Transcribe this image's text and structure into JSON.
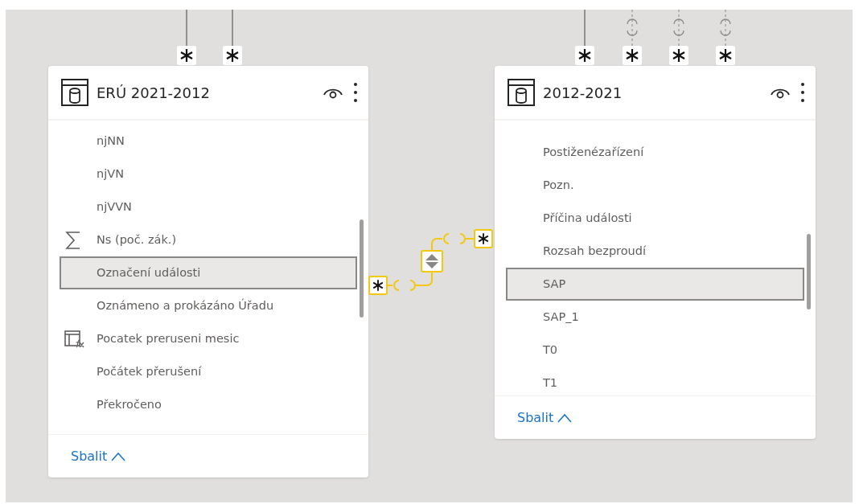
{
  "tables": [
    {
      "title": "ERÚ 2021-2012",
      "connectors": [
        {
          "active": true
        },
        {
          "active": true
        }
      ],
      "fields": [
        {
          "name": "njNN",
          "kind": "column",
          "selected": false
        },
        {
          "name": "njVN",
          "kind": "column",
          "selected": false
        },
        {
          "name": "njVVN",
          "kind": "column",
          "selected": false
        },
        {
          "name": "Ns (poč. zák.)",
          "kind": "measure",
          "selected": false
        },
        {
          "name": "Označení události",
          "kind": "column",
          "selected": true
        },
        {
          "name": "Oznámeno a prokázáno Úřadu",
          "kind": "column",
          "selected": false
        },
        {
          "name": "Pocatek preruseni mesic",
          "kind": "calculated",
          "selected": false
        },
        {
          "name": "Počátek přerušení",
          "kind": "column",
          "selected": false
        },
        {
          "name": "Překročeno",
          "kind": "column",
          "selected": false
        }
      ],
      "collapse_label": "Sbalit"
    },
    {
      "title": "2012-2021",
      "connectors": [
        {
          "active": true
        },
        {
          "active": false
        },
        {
          "active": false
        },
        {
          "active": false
        }
      ],
      "fields": [
        {
          "name": "Postiženézařízení",
          "kind": "column",
          "selected": false
        },
        {
          "name": "Pozn.",
          "kind": "column",
          "selected": false
        },
        {
          "name": "Příčina události",
          "kind": "column",
          "selected": false
        },
        {
          "name": "Rozsah bezproudí",
          "kind": "column",
          "selected": false
        },
        {
          "name": "SAP",
          "kind": "column",
          "selected": true
        },
        {
          "name": "SAP_1",
          "kind": "column",
          "selected": false
        },
        {
          "name": "T0",
          "kind": "column",
          "selected": false
        },
        {
          "name": "T1",
          "kind": "column",
          "selected": false
        }
      ],
      "collapse_label": "Sbalit"
    }
  ]
}
